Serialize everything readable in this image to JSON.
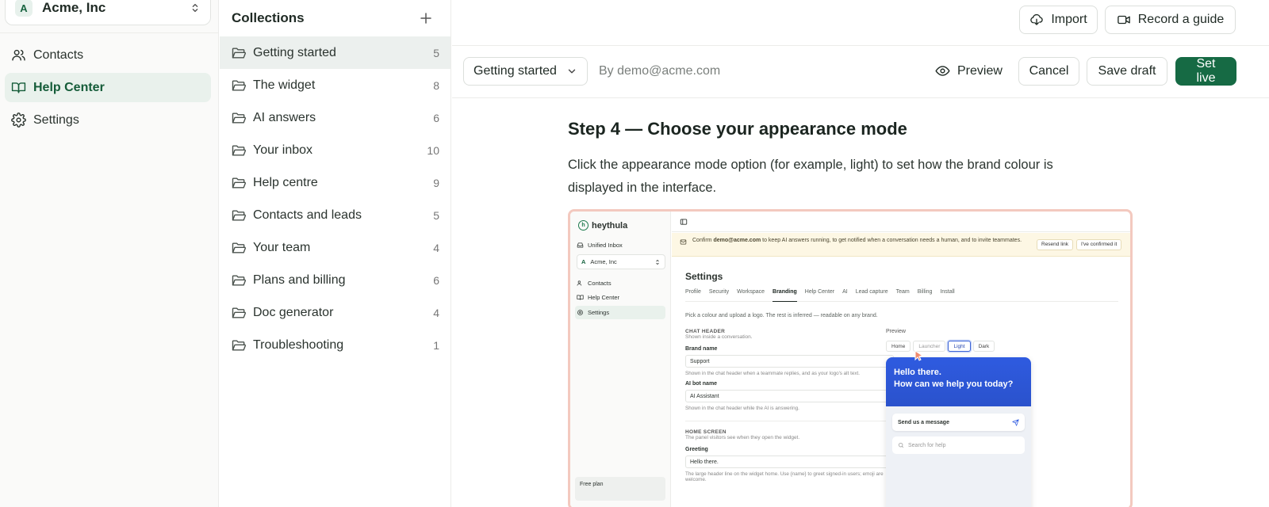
{
  "workspace": {
    "avatar_letter": "A",
    "name": "Acme, Inc"
  },
  "nav": {
    "items": [
      {
        "label": "Contacts",
        "icon": "users-icon",
        "active": false
      },
      {
        "label": "Help Center",
        "icon": "book-icon",
        "active": true
      },
      {
        "label": "Settings",
        "icon": "gear-icon",
        "active": false
      }
    ]
  },
  "collections": {
    "title": "Collections",
    "items": [
      {
        "name": "Getting started",
        "count": "5",
        "active": true
      },
      {
        "name": "The widget",
        "count": "8"
      },
      {
        "name": "AI answers",
        "count": "6"
      },
      {
        "name": "Your inbox",
        "count": "10"
      },
      {
        "name": "Help centre",
        "count": "9"
      },
      {
        "name": "Contacts and leads",
        "count": "5"
      },
      {
        "name": "Your team",
        "count": "4"
      },
      {
        "name": "Plans and billing",
        "count": "6"
      },
      {
        "name": "Doc generator",
        "count": "4"
      },
      {
        "name": "Troubleshooting",
        "count": "1"
      }
    ]
  },
  "header": {
    "import_label": "Import",
    "record_label": "Record a guide"
  },
  "editor": {
    "collection_select": "Getting started",
    "author": "By demo@acme.com",
    "preview_label": "Preview",
    "cancel_label": "Cancel",
    "save_draft_label": "Save draft",
    "set_live_label": "Set live"
  },
  "article": {
    "step_title": "Step 4 — Choose your appearance mode",
    "step_text": "Click the appearance mode option (for example, light) to set how the brand colour is displayed in the interface."
  },
  "embedded": {
    "logo": "heythula",
    "nav": {
      "unified_inbox": "Unified Inbox",
      "workspace": "Acme, Inc",
      "workspace_letter": "A",
      "contacts": "Contacts",
      "help_center": "Help Center",
      "settings": "Settings",
      "plan": "Free plan"
    },
    "banner": {
      "text_pre": "Confirm ",
      "email": "demo@acme.com",
      "text_post": " to keep AI answers running, to get notified when a conversation needs a human, and to invite teammates.",
      "resend": "Resend link",
      "confirmed": "I've confirmed it"
    },
    "settings_title": "Settings",
    "tabs": [
      "Profile",
      "Security",
      "Workspace",
      "Branding",
      "Help Center",
      "AI",
      "Lead capture",
      "Team",
      "Billing",
      "Install"
    ],
    "active_tab": "Branding",
    "hint": "Pick a colour and upload a logo. The rest is inferred — readable on any brand.",
    "chat_header": {
      "section": "CHAT HEADER",
      "sub": "Shown inside a conversation.",
      "brand_label": "Brand name",
      "brand_value": "Support",
      "brand_help": "Shown in the chat header when a teammate replies, and as your logo's alt text.",
      "bot_label": "AI bot name",
      "bot_value": "AI Assistant",
      "bot_help": "Shown in the chat header while the AI is answering."
    },
    "home_screen": {
      "section": "HOME SCREEN",
      "sub": "The panel visitors see when they open the widget.",
      "greeting_label": "Greeting",
      "greeting_value": "Hello there.",
      "greeting_help": "The large header line on the widget home. Use {name} to greet signed-in users; emoji are welcome."
    },
    "preview": {
      "label": "Preview",
      "modes": [
        "Home",
        "Launcher",
        "Light",
        "Dark"
      ],
      "selected": "Light",
      "widget_line1": "Hello there.",
      "widget_line2": "How can we help you today?",
      "send_message": "Send us a message",
      "search_placeholder": "Search for help"
    },
    "colors": {
      "widget_blue": "#2f5be0",
      "brand_green": "#166a44"
    }
  }
}
